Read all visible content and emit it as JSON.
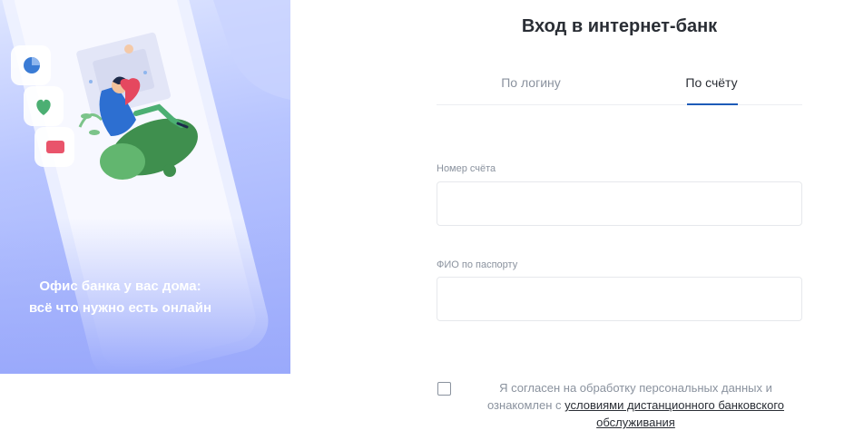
{
  "promo": {
    "line1": "Офис банка у вас дома:",
    "line2": "всё что нужно есть онлайн",
    "illustration_icons": [
      "pie-chart-icon",
      "heart-icon",
      "card-icon"
    ]
  },
  "login": {
    "title": "Вход в интернет-банк",
    "tabs": [
      {
        "label": "По логину",
        "active": false
      },
      {
        "label": "По счёту",
        "active": true
      }
    ],
    "fields": {
      "account_label": "Номер счёта",
      "account_value": "",
      "fio_label": "ФИО по паспорту",
      "fio_value": ""
    },
    "consent": {
      "checked": false,
      "text_before": "Я согласен на обработку персональных данных и ознакомлен с ",
      "link_text": "условиями дистанционного банковского обслуживания"
    }
  },
  "colors": {
    "accent": "#1e5bb8",
    "text_primary": "#2a2e35",
    "text_muted": "#8a929e",
    "promo_gradient_start": "#dfe6ff",
    "promo_gradient_end": "#9aa9fb"
  }
}
